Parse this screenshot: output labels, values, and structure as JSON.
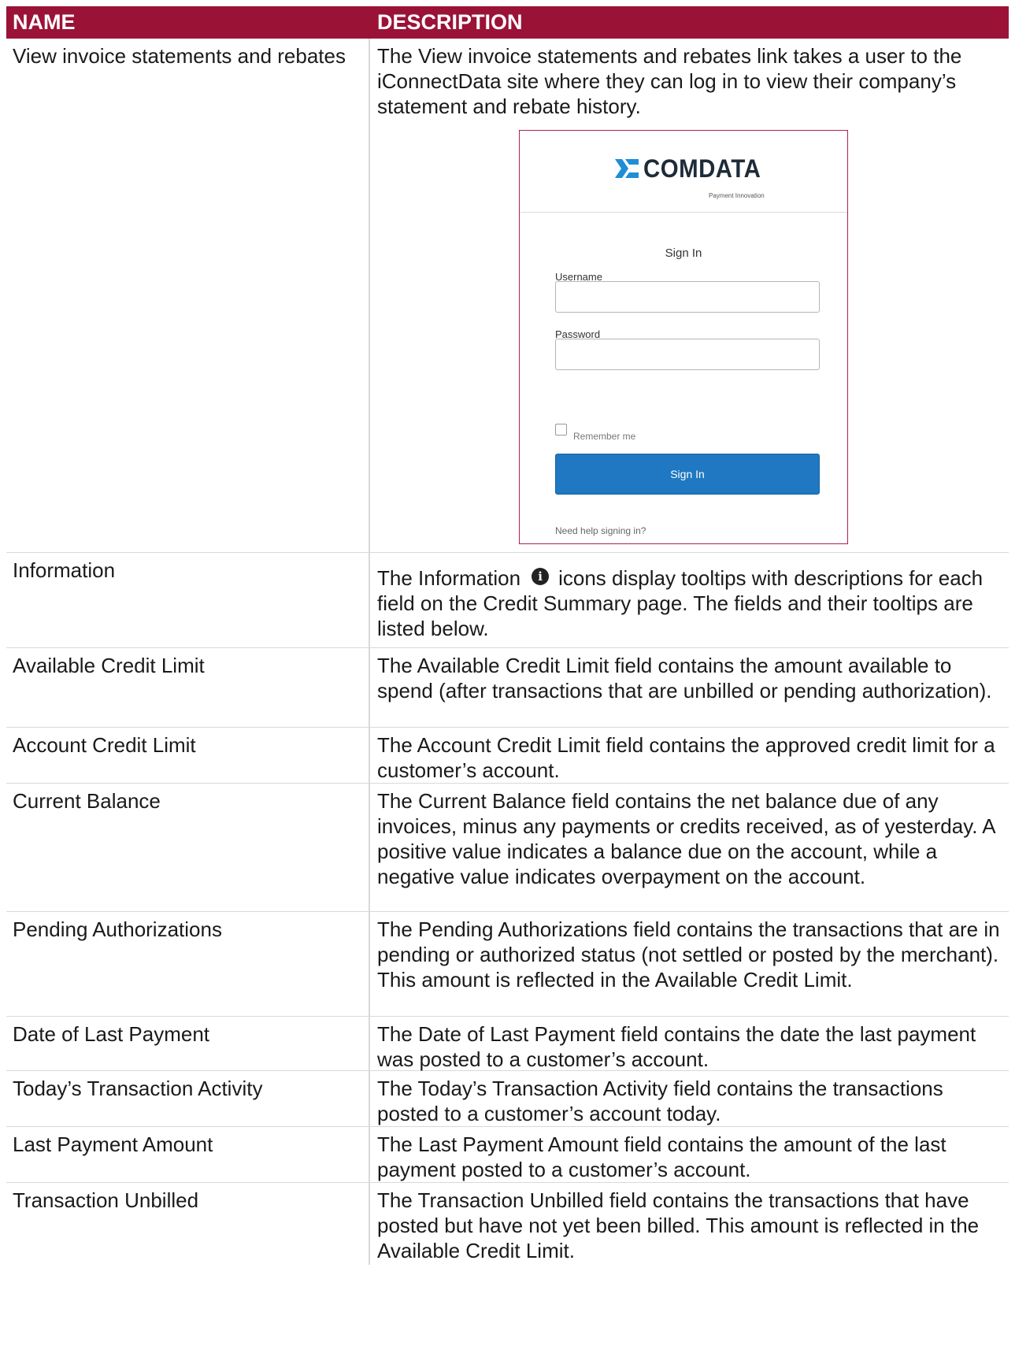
{
  "header": {
    "name": "NAME",
    "description": "DESCRIPTION"
  },
  "rows": [
    {
      "name": "View invoice statements and rebates",
      "description": "The View invoice statements and rebates link takes a user to the iConnectData site where they can log in to view their company’s statement and rebate history."
    },
    {
      "name": "Information",
      "description_before": "The Information",
      "description_after": "icons display tooltips with descriptions for each field on the Credit Summary page. The fields and their tooltips are listed below."
    },
    {
      "name": "Available Credit Limit",
      "description": "The Available Credit Limit field contains the amount available to spend (after transactions that are unbilled or pending authorization)."
    },
    {
      "name": "Account Credit Limit",
      "description": "The Account Credit Limit field contains the approved credit limit for a customer’s account."
    },
    {
      "name": "Current Balance",
      "description": "The Current Balance field contains the net balance due of any invoices, minus any payments or credits received, as of yesterday. A positive value indicates a balance due on the account, while a negative value indicates overpayment on the account."
    },
    {
      "name": "Pending Authorizations",
      "description": "The Pending Authorizations field contains the transactions that are in pending or authorized status (not settled or posted by the merchant). This amount is reflected in the Available Credit Limit."
    },
    {
      "name": "Date of Last Payment",
      "description": "The Date of Last Payment field contains the date the last payment was posted to a customer’s account."
    },
    {
      "name": "Today’s Transaction Activity",
      "description": "The Today’s Transaction Activity field contains the transactions posted to a customer’s account today."
    },
    {
      "name": "Last Payment Amount",
      "description": "The Last Payment Amount field contains the amount of the last payment posted to a customer’s account."
    },
    {
      "name": "Transaction Unbilled",
      "description": "The Transaction Unbilled field contains the transactions that have posted but have not yet been billed. This amount is reflected in the Available Credit Limit."
    }
  ],
  "login": {
    "logo_text": "COMDATA",
    "logo_tagline": "Payment Innovation",
    "title": "Sign In",
    "username_label": "Username",
    "password_label": "Password",
    "remember_label": "Remember me",
    "button_label": "Sign In",
    "help_link": "Need help signing in?"
  },
  "colors": {
    "header_bg": "#9b1237",
    "button_bg": "#1f78c1",
    "logo_accent": "#1f8ed6"
  },
  "icons": {
    "info": "info-circle-icon",
    "logo": "comdata-logo-icon"
  }
}
